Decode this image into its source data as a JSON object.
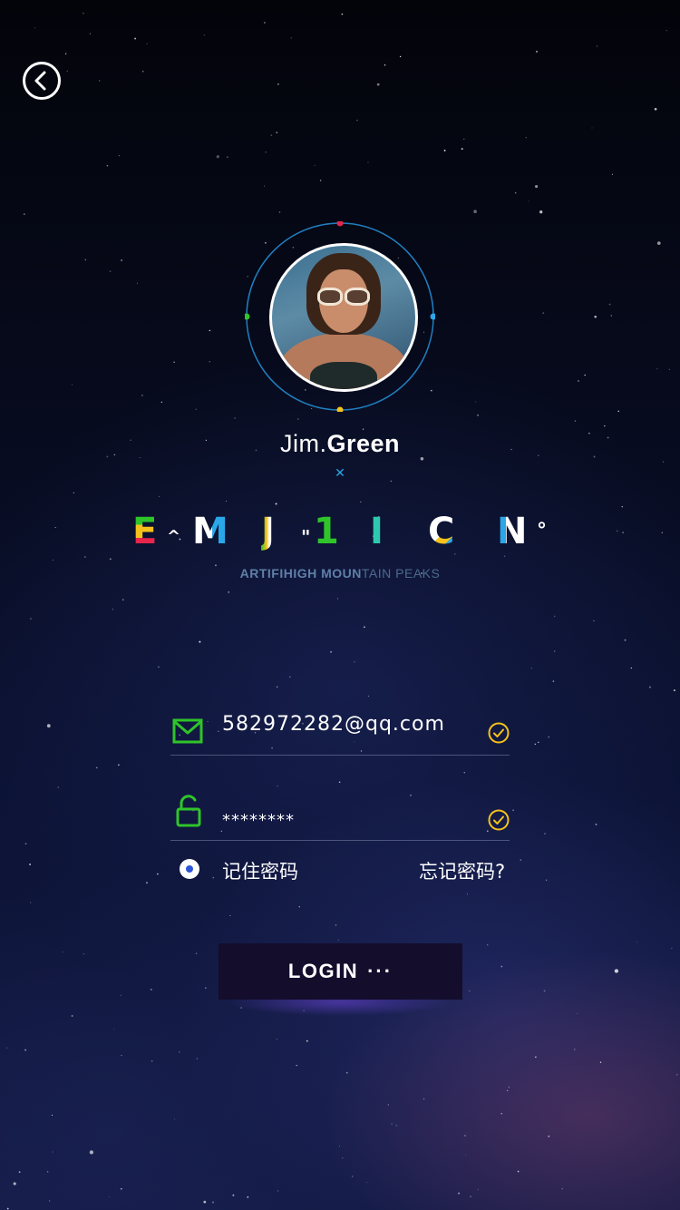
{
  "nav": {
    "back_icon": "chevron-left-circle-icon"
  },
  "profile": {
    "first_name": "Jim.",
    "last_name": "Green"
  },
  "brand": {
    "letters": [
      "E",
      "^",
      "M",
      "J",
      "\"",
      "1",
      "I",
      "C",
      "N",
      "°"
    ],
    "tagline_bold": "ARTIFIHIGH MOUN",
    "tagline_light": "TAIN PEAKS"
  },
  "form": {
    "email": {
      "value": "582972282@qq.com",
      "icon": "mail-icon",
      "status_icon": "check-circle-icon"
    },
    "password": {
      "value": "********",
      "icon": "unlock-icon",
      "status_icon": "check-circle-icon"
    },
    "remember_label": "记住密码",
    "remember_checked": true,
    "forgot_label": "忘记密码?"
  },
  "login": {
    "label": "LOGIN",
    "dots": "···"
  },
  "colors": {
    "icon_green": "#2fc42a",
    "check_yellow": "#f6c21a",
    "ring_blue": "#1f7fc0",
    "dot_red": "#e8254b",
    "dot_green": "#2fc42a",
    "dot_blue": "#2aa7e8",
    "dot_yellow": "#f6c21a",
    "button_bg": "#140d2c"
  }
}
